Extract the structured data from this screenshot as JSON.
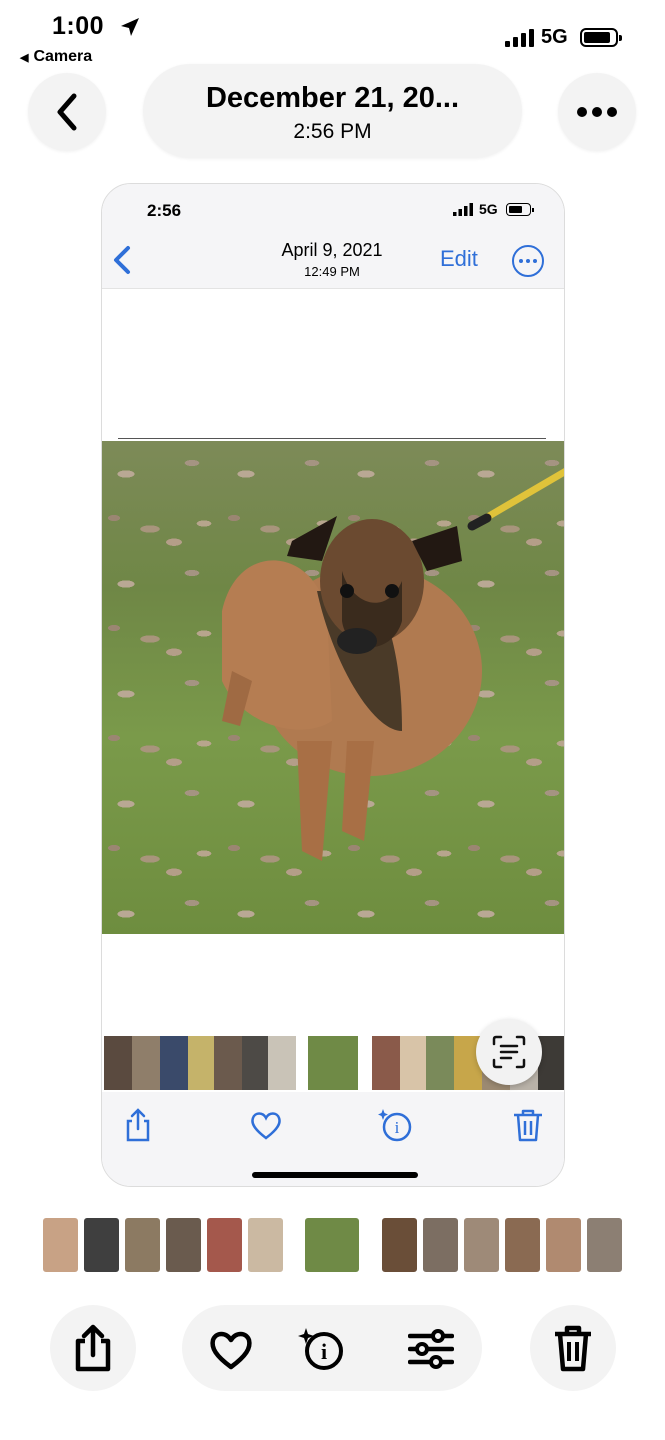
{
  "status_bar": {
    "time": "1:00",
    "back_app": "Camera",
    "network": "5G"
  },
  "header": {
    "title": "December 21, 20...",
    "subtitle": "2:56 PM"
  },
  "inner_screenshot": {
    "status_time": "2:56",
    "network": "5G",
    "title": "April 9, 2021",
    "subtitle": "12:49 PM",
    "edit_label": "Edit"
  },
  "icons": [
    "back-chevron-icon",
    "more-icon",
    "share-icon",
    "heart-icon",
    "info-sparkle-icon",
    "adjust-icon",
    "trash-icon",
    "live-text-icon",
    "location-arrow-icon",
    "signal-icon",
    "battery-icon"
  ],
  "colors": {
    "accent": "#2f6fd8",
    "button_bg": "#f3f3f3"
  }
}
